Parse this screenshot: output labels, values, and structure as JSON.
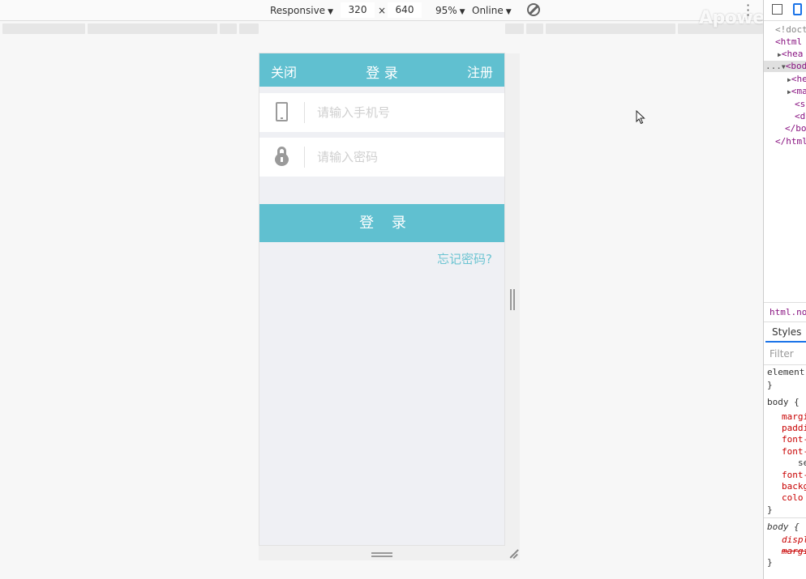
{
  "devtools_toolbar": {
    "device": "Responsive",
    "width": "320",
    "times": "×",
    "height": "640",
    "zoom": "95%",
    "network": "Online"
  },
  "watermark": "ApowerREC",
  "app": {
    "header": {
      "close_label": "关闭",
      "title": "登 录",
      "register_label": "注册"
    },
    "phone_input": {
      "placeholder": "请输入手机号",
      "value": ""
    },
    "password_input": {
      "placeholder": "请输入密码",
      "value": ""
    },
    "login_button": "登 录",
    "forgot_link": "忘记密码?",
    "colors": {
      "brand": "#60c0d0",
      "background": "#eff0f4",
      "placeholder": "#cfcfcf"
    }
  },
  "devpanel": {
    "dom": [
      "<!doct",
      "<html",
      "<hea",
      "<bod",
      "<he",
      "<ma",
      "<s",
      "<d",
      "</bo",
      "</html"
    ],
    "ellipsis": "...",
    "breadcrumb": "html.no-",
    "styles_tab": "Styles",
    "filter_placeholder": "Filter",
    "css": [
      "element",
      "}",
      "body {",
      "margi",
      "paddi",
      "font-",
      "font-",
      "se",
      "font-",
      "backg",
      "colo",
      "}",
      "body {",
      "displ",
      "margi",
      "}"
    ]
  }
}
